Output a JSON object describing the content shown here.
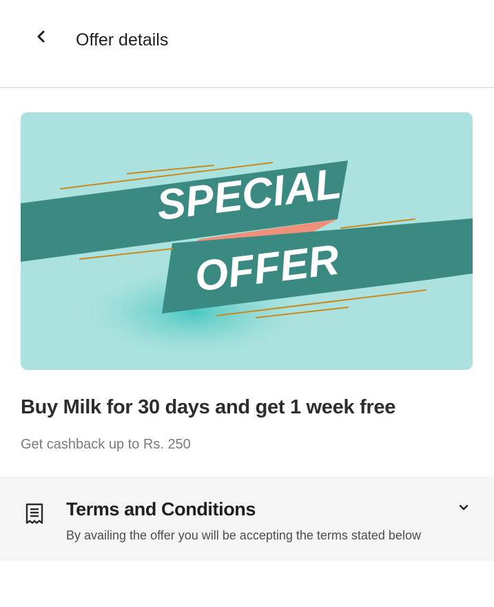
{
  "header": {
    "title": "Offer details",
    "back_icon": "chevron-left-icon"
  },
  "banner": {
    "line1": "SPECIAL",
    "line2": "OFFER",
    "colors": {
      "background": "#abe2df",
      "ribbon": "#3a8a82",
      "accent": "#ef907a",
      "lines": "#c98a1f",
      "text": "#ffffff"
    }
  },
  "offer": {
    "title": "Buy Milk for 30 days and get 1 week free",
    "subtitle": "Get cashback up to Rs. 250"
  },
  "terms": {
    "icon": "receipt-icon",
    "title": "Terms and Conditions",
    "description": "By availing the offer you will be accepting the terms stated below",
    "expand_icon": "chevron-down-icon"
  }
}
